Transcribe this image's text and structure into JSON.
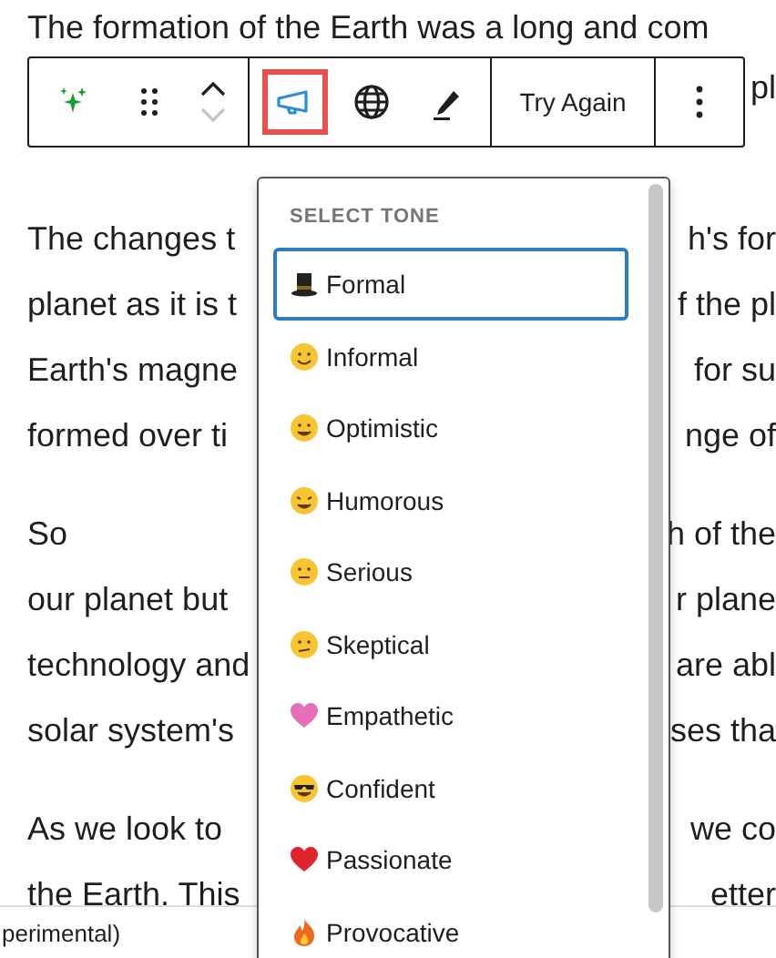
{
  "paragraphs": [
    {
      "lines": [
        {
          "left": "The formation of the Earth was a long and com"
        },
        {
          "right": "pl"
        }
      ]
    },
    {
      "lines": [
        {
          "left": "The changes t",
          "right": "h's for"
        },
        {
          "left": "planet as it is t",
          "right": "f the pl"
        },
        {
          "left": "Earth's magne",
          "right": "for su"
        },
        {
          "left": "formed over ti",
          "right": "nge of"
        }
      ]
    },
    {
      "lines": [
        {
          "left": "So",
          "right": "h of the"
        },
        {
          "left": "our planet but",
          "right": "r plane"
        },
        {
          "left": "technology and",
          "right": "are abl"
        },
        {
          "left": "solar system's",
          "right": "ses tha"
        }
      ]
    },
    {
      "lines": [
        {
          "left": "As we look to",
          "right": "we co"
        },
        {
          "left": "the Earth. This",
          "right": "etter"
        }
      ]
    }
  ],
  "toolbar": {
    "groups": [
      {
        "tools": [
          {
            "kind": "sparkle"
          },
          {
            "kind": "drag"
          },
          {
            "kind": "mover",
            "down_disabled": true
          }
        ]
      },
      {
        "tools": [
          {
            "kind": "megaphone",
            "highlighted": true
          },
          {
            "kind": "globe",
            "highlighted": false
          },
          {
            "kind": "pen",
            "highlighted": false
          }
        ]
      },
      {
        "tools": [
          {
            "kind": "text",
            "label": "Try Again"
          }
        ]
      },
      {
        "tools": [
          {
            "kind": "more"
          }
        ]
      }
    ]
  },
  "status_bar": {
    "text": "perimental)"
  },
  "tone_menu": {
    "heading": "SELECT TONE",
    "options": [
      {
        "label": "Formal",
        "kind": "tophat",
        "selected": true
      },
      {
        "label": "Informal",
        "kind": "smile",
        "selected": false
      },
      {
        "label": "Optimistic",
        "kind": "grin",
        "selected": false
      },
      {
        "label": "Humorous",
        "kind": "laugh",
        "selected": false
      },
      {
        "label": "Serious",
        "kind": "neutral",
        "selected": false
      },
      {
        "label": "Skeptical",
        "kind": "skeptic",
        "selected": false
      },
      {
        "label": "Empathetic",
        "kind": "pinkheart",
        "selected": false
      },
      {
        "label": "Confident",
        "kind": "sunglasses",
        "selected": false
      },
      {
        "label": "Passionate",
        "kind": "redheart",
        "selected": false
      },
      {
        "label": "Provocative",
        "kind": "fire",
        "selected": false
      }
    ]
  }
}
